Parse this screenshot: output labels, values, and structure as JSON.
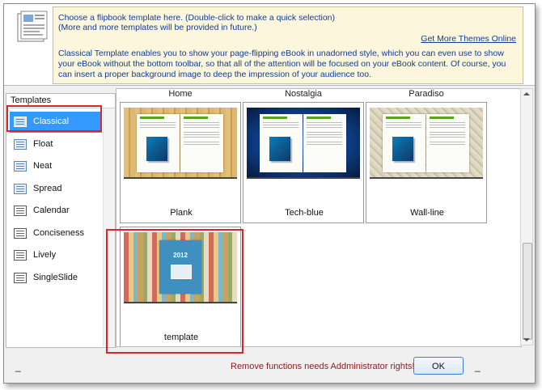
{
  "header": {
    "line1": "Choose a flipbook template here. (Double-click to make a quick selection)",
    "line2": "(More and more templates will be provided in future.)",
    "more_themes_link": "Get More Themes Online",
    "description": "Classical Template enables you to show your page-flipping eBook in unadorned style, which you can even use to show your eBook without the bottom toolbar, so that all of the attention will be focused on your eBook content. Of course, you can insert a proper background image to deep the impression of your audience too.",
    "icon": "book-template-icon"
  },
  "sidebar": {
    "title": "Templates",
    "selected": "Classical",
    "items": [
      {
        "label": "Classical",
        "icon": "classical-template-icon"
      },
      {
        "label": "Float",
        "icon": "float-template-icon"
      },
      {
        "label": "Neat",
        "icon": "neat-template-icon"
      },
      {
        "label": "Spread",
        "icon": "spread-template-icon"
      },
      {
        "label": "Calendar",
        "icon": "calendar-template-icon"
      },
      {
        "label": "Conciseness",
        "icon": "conciseness-template-icon"
      },
      {
        "label": "Lively",
        "icon": "lively-template-icon"
      },
      {
        "label": "SingleSlide",
        "icon": "singleslide-template-icon"
      }
    ]
  },
  "gallery": {
    "top_row_labels": [
      "Home",
      "Nostalgia",
      "Paradiso"
    ],
    "cards": [
      {
        "name": "Plank",
        "bg_color": "#d7b36a"
      },
      {
        "name": "Tech-blue",
        "bg_color": "#0f3f8a"
      },
      {
        "name": "Wall-line",
        "bg_color": "#d9d3bf"
      },
      {
        "name": "template",
        "bg_color": "#c8a25e",
        "thumb_title": "2012"
      }
    ]
  },
  "footer": {
    "left_dash": "_",
    "right_dash": "_",
    "message": "Remove functions needs Addministrator rights!",
    "ok_label": "OK"
  },
  "colors": {
    "selection": "#3399ff",
    "highlight_box": "#d9262c",
    "info_text": "#123d92",
    "warning_text": "#8b1a1a"
  }
}
